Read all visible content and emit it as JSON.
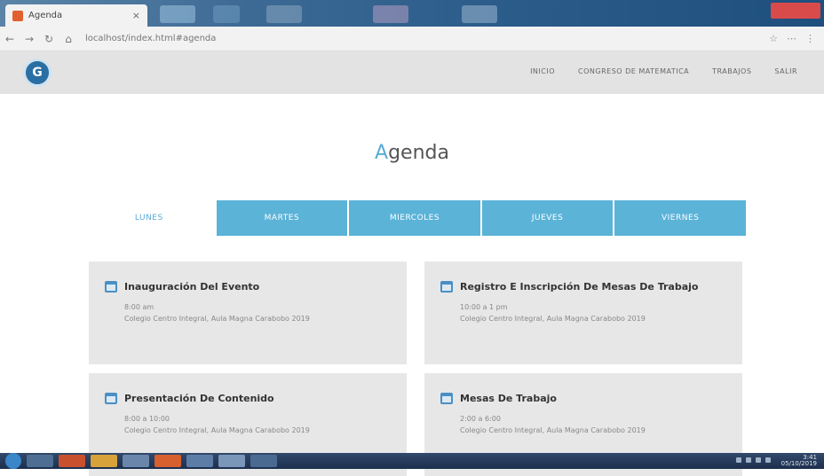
{
  "browser": {
    "tab_title": "Agenda",
    "tab_close": "×",
    "url": "localhost/index.html#agenda",
    "nav_back": "←",
    "nav_forward": "→",
    "nav_reload": "↻",
    "nav_home": "⌂",
    "toolbar_icons": [
      "☆",
      "⋯",
      "⋮"
    ]
  },
  "site": {
    "logo_text": "G",
    "nav": [
      "INICIO",
      "CONGRESO DE MATEMATICA",
      "TRABAJOS",
      "SALIR"
    ]
  },
  "page": {
    "title_first": "A",
    "title_rest": "genda"
  },
  "days": [
    {
      "label": "LUNES",
      "active": true
    },
    {
      "label": "MARTES",
      "active": false
    },
    {
      "label": "MIERCOLES",
      "active": false
    },
    {
      "label": "JUEVES",
      "active": false
    },
    {
      "label": "VIERNES",
      "active": false
    }
  ],
  "events": [
    {
      "title": "Inauguración Del Evento",
      "time": "8:00 am",
      "place": "Colegio Centro Integral, Aula Magna Carabobo 2019"
    },
    {
      "title": "Registro E Inscripción De Mesas De Trabajo",
      "time": "10:00 a 1 pm",
      "place": "Colegio Centro Integral, Aula Magna Carabobo 2019"
    },
    {
      "title": "Presentación De Contenido",
      "time": "8:00 a 10:00",
      "place": "Colegio Centro Integral, Aula Magna Carabobo 2019"
    },
    {
      "title": "Mesas De Trabajo",
      "time": "2:00 a 6:00",
      "place": "Colegio Centro Integral, Aula Magna Carabobo 2019"
    }
  ],
  "taskbar": {
    "time": "3:41",
    "date": "05/10/2019"
  },
  "colors": {
    "accent": "#5bb3d8",
    "header_bg": "#e3e3e3",
    "card_bg": "#e7e7e7",
    "icon": "#4a8fc4"
  }
}
